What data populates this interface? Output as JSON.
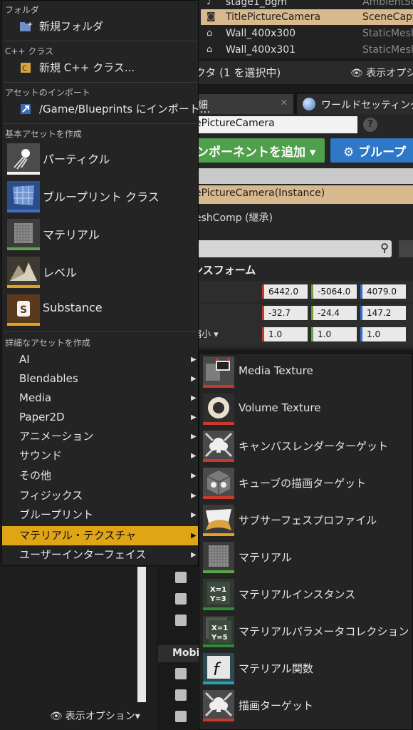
{
  "outliner": {
    "rows": [
      {
        "name": "stage1_bgm",
        "type": "AmbientSo",
        "icon": "sound-icon",
        "selected": false
      },
      {
        "name": "TitlePictureCamera",
        "type": "SceneCapt",
        "icon": "camera-icon",
        "selected": true
      },
      {
        "name": "Wall_400x300",
        "type": "StaticMesh",
        "icon": "static-mesh-icon",
        "selected": false
      },
      {
        "name": "Wall_400x301",
        "type": "StaticMesh",
        "icon": "static-mesh-icon",
        "selected": false
      }
    ],
    "selection_status": "クタ (1 を選択中)",
    "view_options": "表示オプシ"
  },
  "details": {
    "tab_details": "細",
    "tab_world": "ワールドセッティング",
    "name_value": "ePictureCamera",
    "add_component": "ンポーネントを追加 ▾",
    "blueprint": "⚙ ブループ",
    "instance_row": "ePictureCamera(Instance)",
    "inherited_row": "eshComp (継承)",
    "transform_label": "ンスフォーム",
    "scale_label": "縮小 ▾",
    "location": {
      "x": "6442.0",
      "y": "-5064.0",
      "z": "4079.0"
    },
    "rotation": {
      "x": "-32.7",
      "y": "-24.4",
      "z": "147.2"
    },
    "scale": {
      "x": "1.0",
      "y": "1.0",
      "z": "1.0"
    }
  },
  "left_panel": {
    "view_options": "表示オプション▾",
    "mobility_header": "Mobi"
  },
  "menu": {
    "sections": {
      "folder": "フォルダ",
      "cpp": "C++ クラス",
      "import": "アセットのインポート",
      "basic": "基本アセットを作成",
      "advanced": "詳細なアセットを作成"
    },
    "new_folder": "新規フォルダ",
    "new_cpp": "新規 C++ クラス...",
    "import_to": "/Game/Blueprints にインポート...",
    "basic_assets": [
      {
        "label": "パーティクル",
        "icon": "particle-icon",
        "accent": "#ffffff"
      },
      {
        "label": "ブループリント クラス",
        "icon": "blueprint-icon",
        "accent": "#3f6fc7"
      },
      {
        "label": "マテリアル",
        "icon": "material-icon",
        "accent": "#58a84a"
      },
      {
        "label": "レベル",
        "icon": "level-icon",
        "accent": "#e3a21a"
      },
      {
        "label": "Substance",
        "icon": "substance-icon",
        "accent": "#e3a21a"
      }
    ],
    "advanced_items": [
      {
        "label": "AI",
        "highlighted": false
      },
      {
        "label": "Blendables",
        "highlighted": false
      },
      {
        "label": "Media",
        "highlighted": false
      },
      {
        "label": "Paper2D",
        "highlighted": false
      },
      {
        "label": "アニメーション",
        "highlighted": false
      },
      {
        "label": "サウンド",
        "highlighted": false
      },
      {
        "label": "その他",
        "highlighted": false
      },
      {
        "label": "フィジックス",
        "highlighted": false
      },
      {
        "label": "ブループリント",
        "highlighted": false
      },
      {
        "label": "マテリアル・テクスチャ",
        "highlighted": true
      },
      {
        "label": "ユーザーインターフェイス",
        "highlighted": false
      }
    ],
    "highlight_color": "#e0a515"
  },
  "submenu": {
    "items": [
      {
        "label": "Media Texture",
        "icon": "media-texture-icon",
        "accent": "#c8392b"
      },
      {
        "label": "Volume Texture",
        "icon": "volume-texture-icon",
        "accent": "#c8392b"
      },
      {
        "label": "キャンバスレンダーターゲット",
        "icon": "canvas-render-target-icon",
        "accent": "#c8392b"
      },
      {
        "label": "キューブの描画ターゲット",
        "icon": "cube-render-target-icon",
        "accent": "#c8392b"
      },
      {
        "label": "サブサーフェスプロファイル",
        "icon": "subsurface-profile-icon",
        "accent": "#e3a21a"
      },
      {
        "label": "マテリアル",
        "icon": "material-icon",
        "accent": "#58a84a"
      },
      {
        "label": "マテリアルインスタンス",
        "icon": "material-instance-icon",
        "accent": "#2e8b3a"
      },
      {
        "label": "マテリアルパラメータコレクション",
        "icon": "material-parameter-collection-icon",
        "accent": "#2e8b3a"
      },
      {
        "label": "マテリアル関数",
        "icon": "material-function-icon",
        "accent": "#27a0b3"
      },
      {
        "label": "描画ターゲット",
        "icon": "render-target-icon",
        "accent": "#c8392b"
      }
    ]
  }
}
